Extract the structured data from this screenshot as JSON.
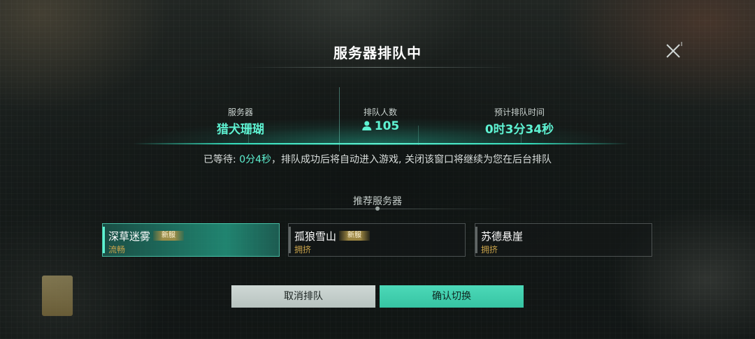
{
  "dialog": {
    "title": "服务器排队中"
  },
  "info": {
    "server_label": "服务器",
    "server_value": "猎犬珊瑚",
    "queue_label": "排队人数",
    "queue_value": "105",
    "eta_label": "预计排队时间",
    "eta_value": "0时3分34秒"
  },
  "wait": {
    "prefix": "已等待: ",
    "elapsed": "0分4秒",
    "suffix": "，排队成功后将自动进入游戏, 关闭该窗口将继续为您在后台排队"
  },
  "recommended": {
    "title": "推荐服务器",
    "servers": [
      {
        "name": "深草迷雾",
        "badge": "新服",
        "status": "流畅"
      },
      {
        "name": "孤狼雪山",
        "badge": "新服",
        "status": "拥挤"
      },
      {
        "name": "苏德悬崖",
        "badge": "",
        "status": "拥挤"
      }
    ]
  },
  "buttons": {
    "cancel_label": "取消排队",
    "confirm_label": "确认切换"
  },
  "colors": {
    "accent": "#5ef2d2",
    "status_text": "#c9a34a",
    "confirm_button": "#3fd0ae",
    "cancel_button": "#c3cdca"
  }
}
